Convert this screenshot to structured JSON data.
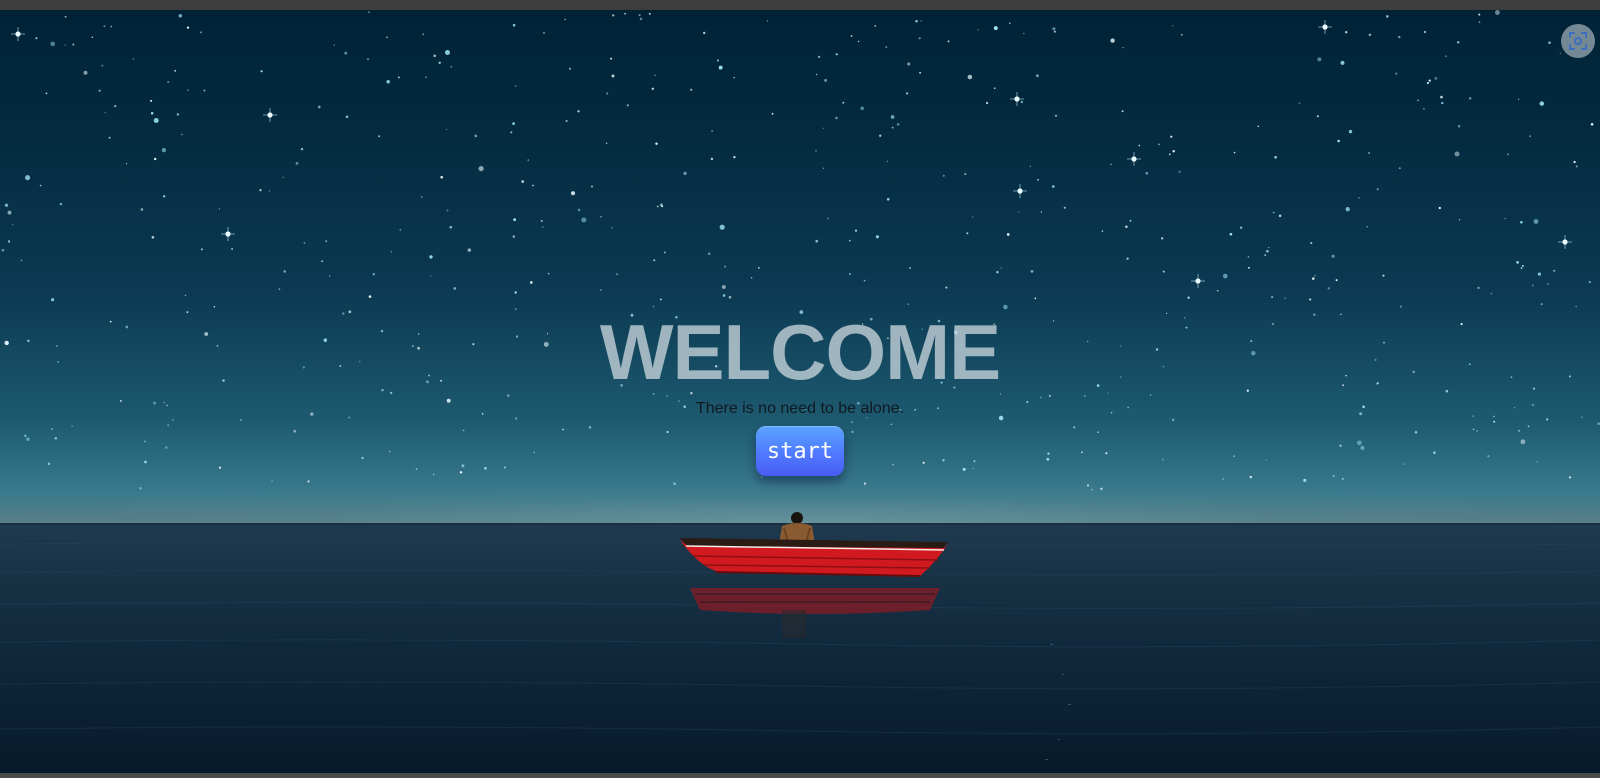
{
  "hero": {
    "title": "WELCOME",
    "tagline": "There is no need to be alone.",
    "start_label": "start"
  },
  "controls": {
    "fullscreen_icon": "screenshot-focus-icon"
  },
  "colors": {
    "sky_top": "#012236",
    "sky_horizon": "#3a7a8c",
    "water": "#10283b",
    "boat": "#d11a1f",
    "button_top": "#5aa4ff",
    "button_bottom": "#4a5cf5",
    "title": "#becdd4"
  }
}
